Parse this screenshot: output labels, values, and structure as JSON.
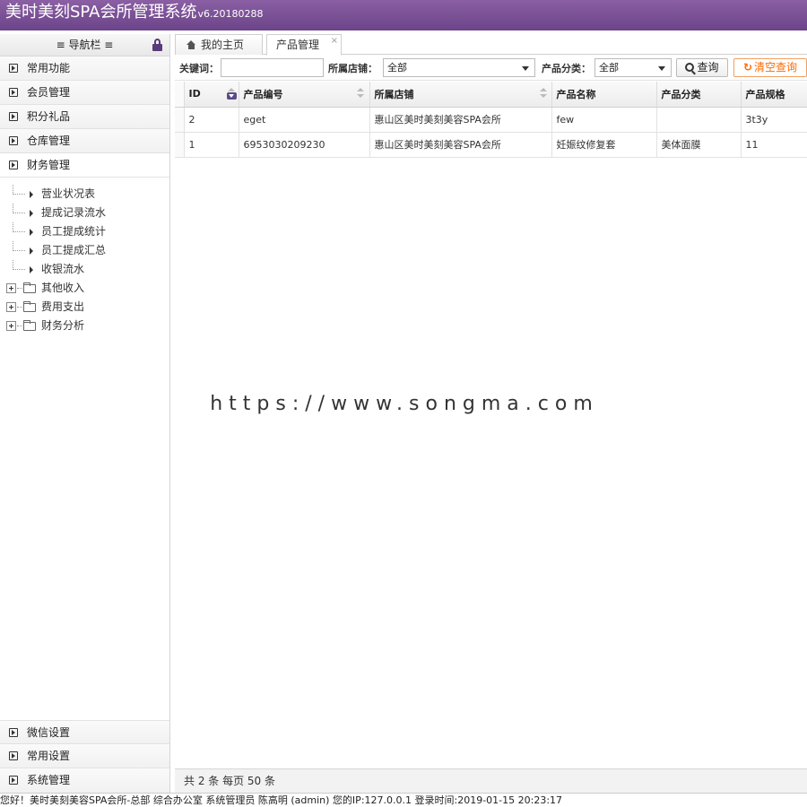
{
  "header": {
    "title": "美时美刻SPA会所管理系统",
    "version": "v6.20180288",
    "bg_color": "#6c4489"
  },
  "sidebar": {
    "nav_title": "≡ 导航栏 ≡",
    "top_items": [
      {
        "label": "常用功能"
      },
      {
        "label": "会员管理"
      },
      {
        "label": "积分礼品"
      },
      {
        "label": "仓库管理"
      },
      {
        "label": "财务管理"
      }
    ],
    "tree": {
      "leaves": [
        {
          "label": "营业状况表"
        },
        {
          "label": "提成记录流水"
        },
        {
          "label": "员工提成统计"
        },
        {
          "label": "员工提成汇总"
        },
        {
          "label": "收银流水"
        }
      ],
      "folders": [
        {
          "label": "其他收入"
        },
        {
          "label": "费用支出"
        },
        {
          "label": "财务分析"
        }
      ]
    },
    "bottom_items": [
      {
        "label": "微信设置"
      },
      {
        "label": "常用设置"
      },
      {
        "label": "系统管理"
      }
    ]
  },
  "tabs": {
    "home": "我的主页",
    "active": "产品管理",
    "close": "×"
  },
  "filter": {
    "keyword_label": "关键词：",
    "keyword_value": "",
    "store_label": "所属店铺：",
    "store_value": "全部",
    "category_label": "产品分类：",
    "category_value": "全部",
    "search_button": "查询",
    "clear_button": "清空查询",
    "clear_icon": "↻",
    "accent_color": "#ff6a00"
  },
  "grid": {
    "columns": [
      "ID",
      "产品编号",
      "所属店铺",
      "产品名称",
      "产品分类",
      "产品规格"
    ],
    "rows": [
      [
        "2",
        "eget",
        "惠山区美时美刻美容SPA会所",
        "few",
        "",
        "3t3y"
      ],
      [
        "1",
        "6953030209230",
        "惠山区美时美刻美容SPA会所",
        "妊娠纹修复套",
        "美体面膜",
        "11"
      ]
    ]
  },
  "pager": {
    "text": "共 2 条 每页 50 条"
  },
  "watermark": "https://www.songma.com",
  "status_bar": "您好！美时美刻美容SPA会所-总部 综合办公室 系统管理员 陈高明 (admin) 您的IP:127.0.0.1 登录时间:2019-01-15 20:23:17"
}
